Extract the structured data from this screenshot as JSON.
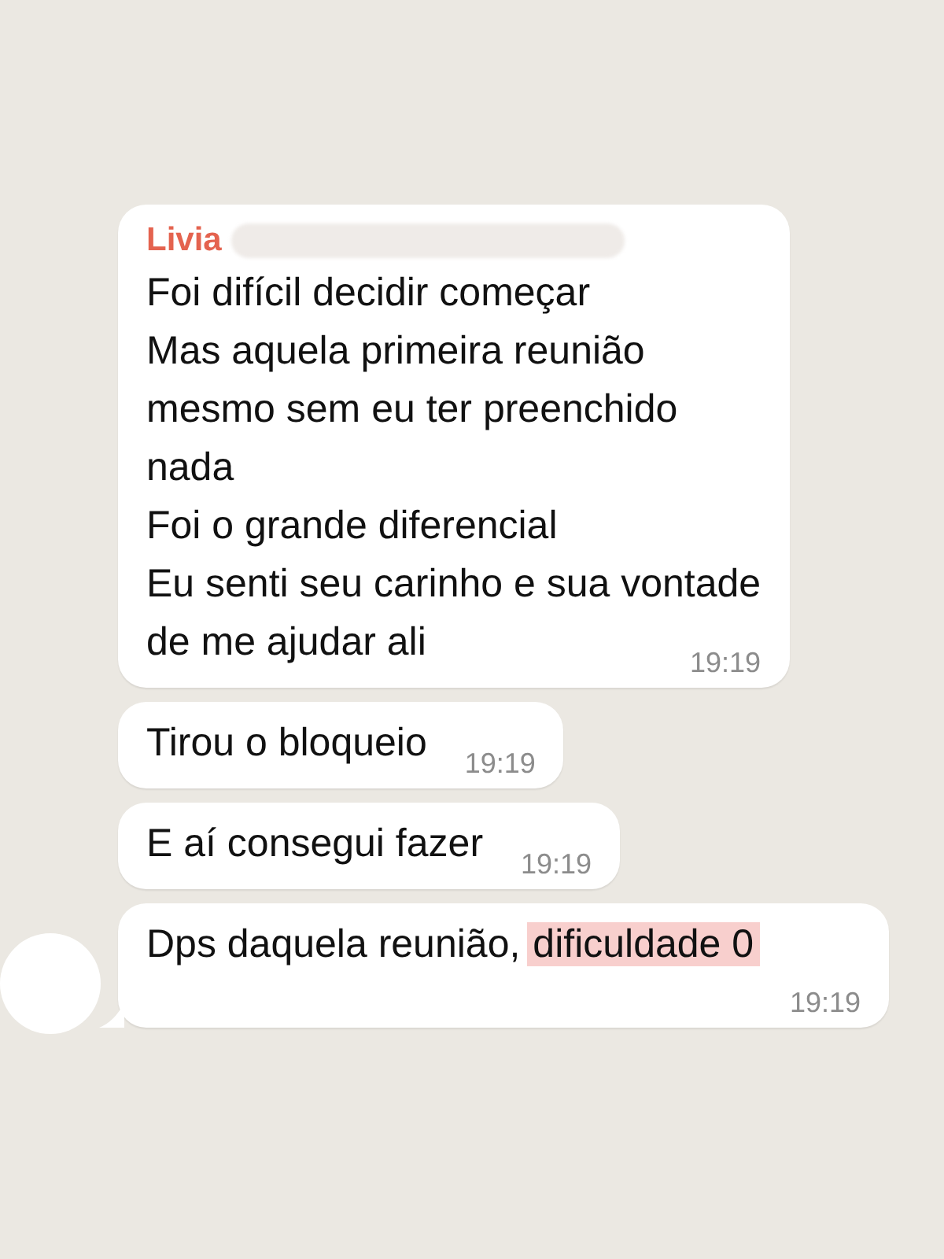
{
  "messages": [
    {
      "sender": {
        "name": "Livia",
        "redacted": true
      },
      "lines": [
        "Foi difícil decidir começar",
        "Mas aquela primeira reunião",
        "mesmo sem eu ter preenchido",
        "nada",
        "Foi o grande diferencial",
        "Eu senti seu carinho e sua vontade",
        "de me ajudar ali"
      ],
      "time": "19:19"
    },
    {
      "lines": [
        "Tirou o bloqueio"
      ],
      "time": "19:19"
    },
    {
      "lines": [
        "E aí consegui fazer"
      ],
      "time": "19:19"
    },
    {
      "lines": [
        "Dps daquela reunião,"
      ],
      "highlight": "dificuldade 0",
      "time": "19:19",
      "avatar": true
    }
  ]
}
